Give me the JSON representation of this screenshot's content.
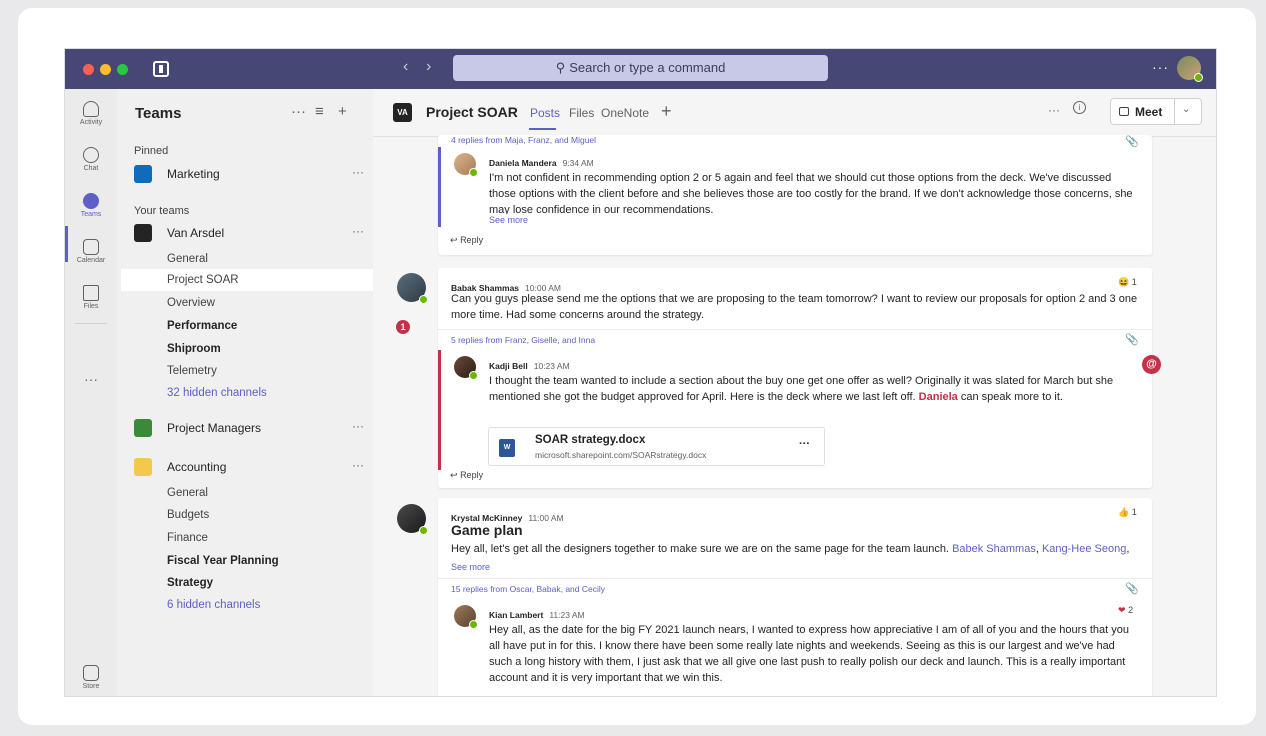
{
  "search": {
    "placeholder": "Search or type a command"
  },
  "rail": [
    {
      "label": "Activity"
    },
    {
      "label": "Chat"
    },
    {
      "label": "Teams"
    },
    {
      "label": "Calendar"
    },
    {
      "label": "Files"
    },
    {
      "label": "Store"
    }
  ],
  "panel": {
    "title": "Teams",
    "pinned_label": "Pinned",
    "your_teams_label": "Your teams",
    "pinned_team": "Marketing",
    "team1": {
      "name": "Van Arsdel",
      "channels": [
        "General",
        "Project SOAR",
        "Overview",
        "Performance",
        "Shiproom",
        "Telemetry"
      ],
      "hidden": "32 hidden channels",
      "badge": "1"
    },
    "team2": {
      "name": "Project Managers"
    },
    "team3": {
      "name": "Accounting",
      "channels": [
        "General",
        "Budgets",
        "Finance",
        "Fiscal Year Planning",
        "Strategy"
      ],
      "hidden": "6 hidden channels"
    }
  },
  "header": {
    "channel": "Project SOAR",
    "logo_text": "VA",
    "tabs": [
      "Posts",
      "Files",
      "OneNote"
    ],
    "meet_label": "Meet"
  },
  "thread0": {
    "replies": "4 replies from Maja, Franz, and Miguel",
    "sender": "Daniela Mandera",
    "time": "9:34 AM",
    "text": "I'm not confident in recommending option 2 or 5 again and feel that we should cut those options from the deck. We've discussed those options with the client before and she believes those are too costly for the brand. If we don't acknowledge those concerns, she may lose confidence in our recommendations.",
    "see_more": "See more",
    "reply": "Reply"
  },
  "post1": {
    "sender": "Babak Shammas",
    "time": "10:00 AM",
    "text": "Can you guys please send me the options that we are proposing to the team tomorrow? I want to review our proposals for option 2 and 3 one more time. Had some concerns around the strategy.",
    "reaction_count": "1",
    "replies": "5 replies from Franz, Giselle, and Inna",
    "reply_sender": "Kadji Bell",
    "reply_time": "10:23 AM",
    "reply_text_1": "I thought the team wanted to include a section about the buy one get one offer as well? Originally it was slated for March but she mentioned she got the budget approved for April. Here is the deck where we last left off.",
    "reply_mention": "Daniela",
    "reply_text_2": "can speak more to it.",
    "file_name": "SOAR strategy.docx",
    "file_url": "microsoft.sharepoint.com/SOARstrategy.docx",
    "file_icon_text": "W",
    "reply": "Reply",
    "at_badge": "@"
  },
  "post2": {
    "sender": "Krystal McKinney",
    "time": "11:00 AM",
    "subject": "Game plan",
    "text": "Hey all, let's get all the designers together to make sure we are on the same page for the team launch.",
    "mention1": "Babek Shammas",
    "mention2": "Kang-Hee Seong",
    "see_more": "See more",
    "reaction_count": "1",
    "replies": "15 replies from Oscar, Babak, and Cecily",
    "reply_sender": "Kian Lambert",
    "reply_time": "11:23 AM",
    "reply_text": "Hey all, as the date for the big FY 2021 launch nears, I wanted to express how appreciative I am of all of you and the hours that you all have put in for this. I know there have been some really late nights and weekends. Seeing as this is our largest and we've had such a long history with them, I just ask that we all give one last push to really polish our deck and launch. This is a really important account and it is very important that we win this.",
    "heart_count": "2"
  },
  "colors": {
    "brand": "#464775",
    "accent": "#5b5fc7",
    "mention": "#c4314b",
    "presence": "#6bb700"
  }
}
